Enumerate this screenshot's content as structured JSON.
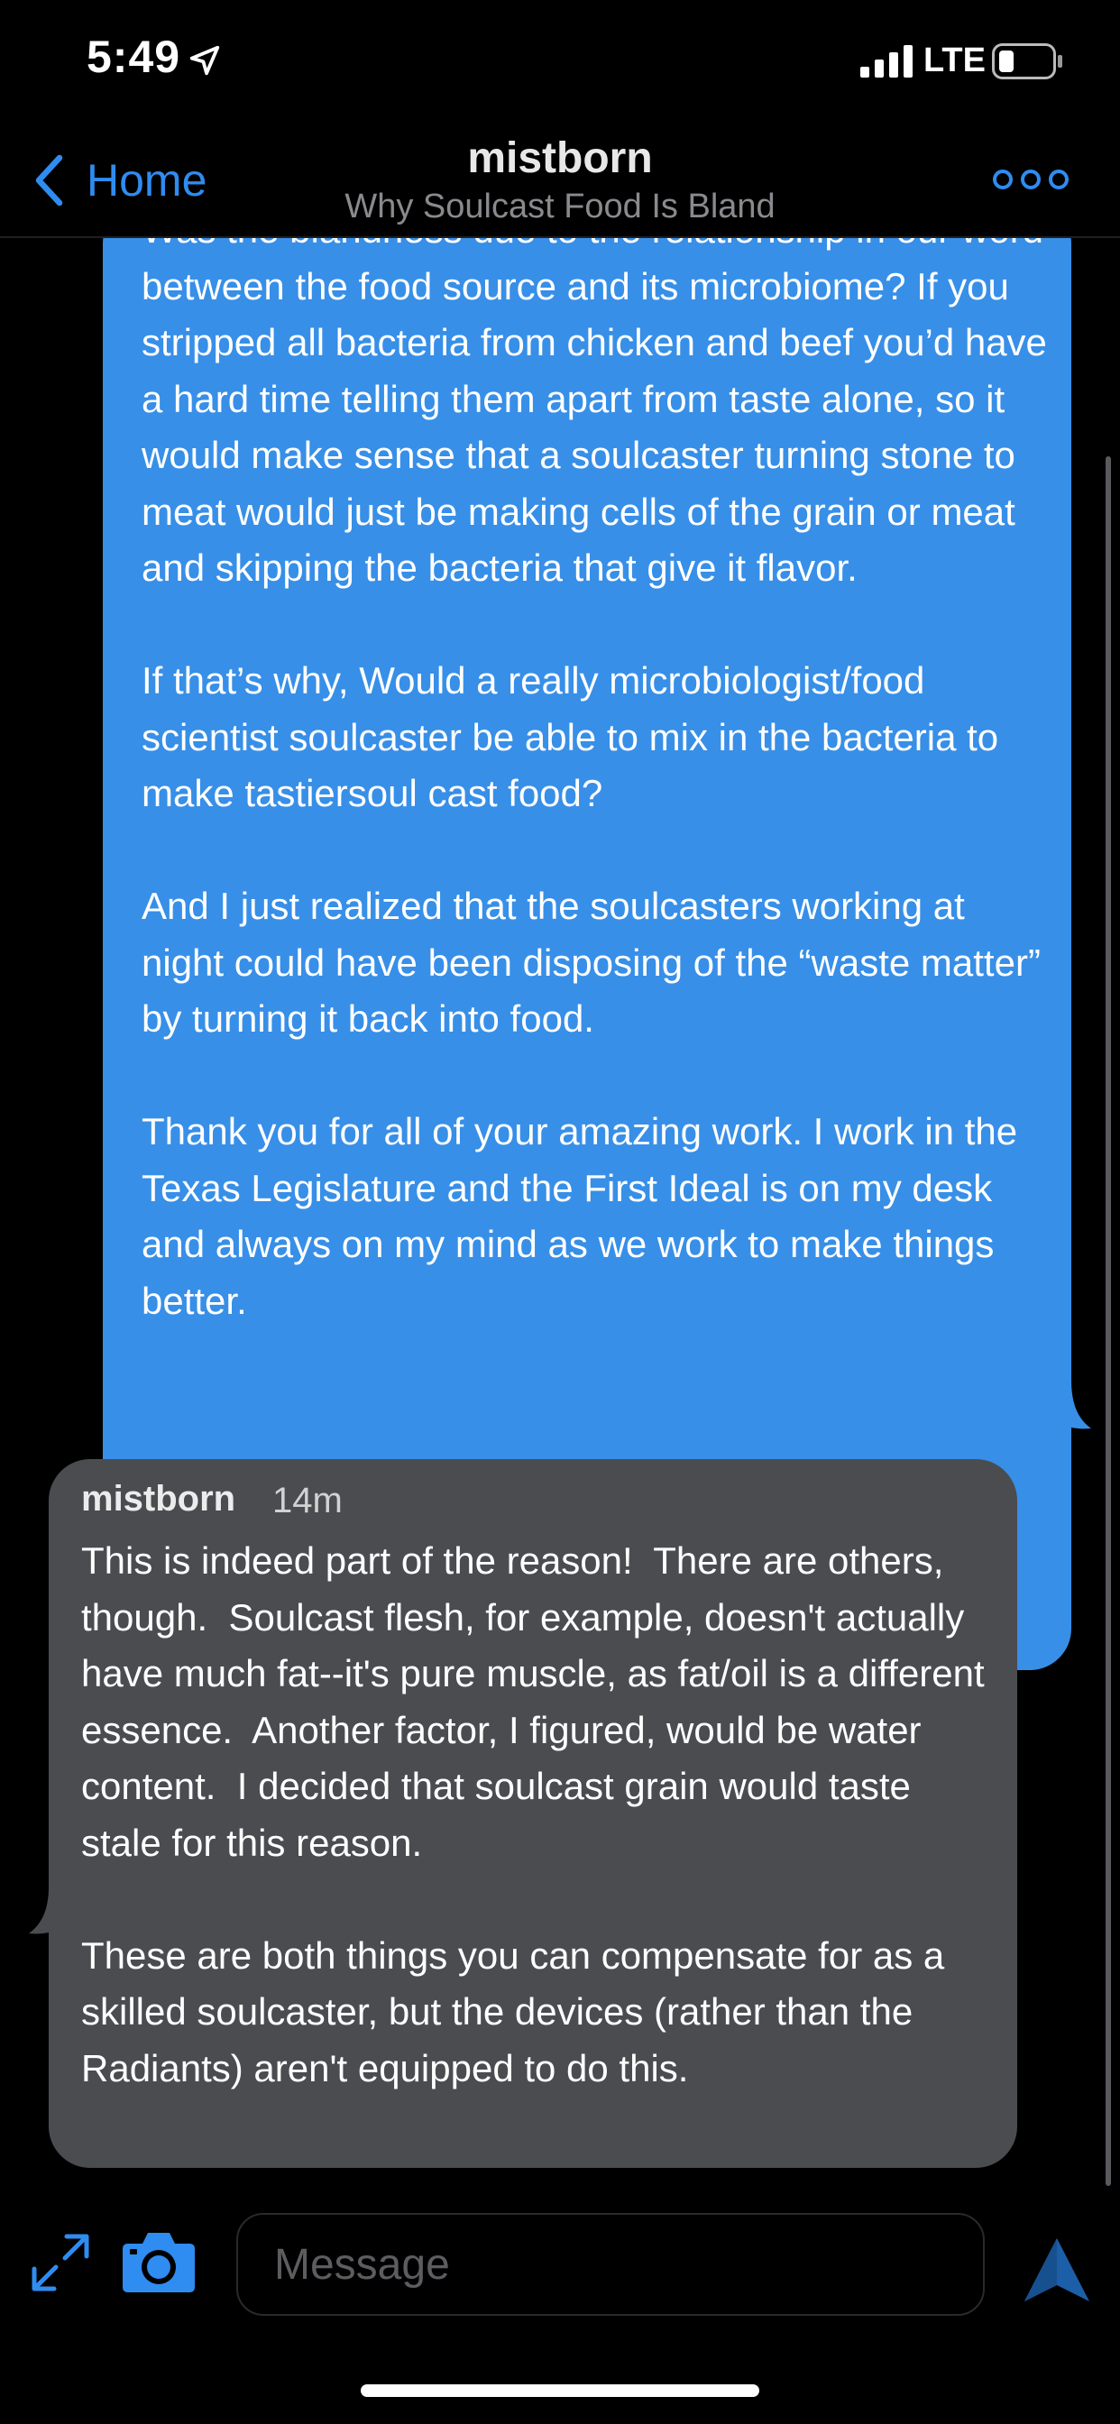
{
  "status_bar": {
    "time": "5:49",
    "network": "LTE",
    "location_icon": "location-arrow-icon",
    "signal_icon": "cellular-signal-icon",
    "battery_icon": "battery-low-icon"
  },
  "header": {
    "back_label": "Home",
    "title": "mistborn",
    "subtitle": "Why Soulcast Food Is Bland",
    "more_icon": "more-options-icon"
  },
  "messages": [
    {
      "direction": "outgoing",
      "text": "Was the blandness due to the relationship in our word between the food source and its microbiome? If you stripped all bacteria from chicken and beef you’d have a hard time telling them apart from taste alone, so it would make sense that a soulcaster turning stone to meat would just be making cells of the grain or meat and skipping the bacteria that give it flavor.\n\nIf that’s why, Would a really microbiologist/food scientist soulcaster be able to mix in the bacteria to make tastiersoul cast food?\n\nAnd I just realized that the soulcasters working at night could have been disposing of the “waste matter” by turning it back into food.\n\nThank you for all of your amazing work. I work in the Texas Legislature and the First Ideal is on my desk and always on my mind as we work to make things better.",
      "color": "#378fe8"
    },
    {
      "direction": "incoming",
      "author": "mistborn",
      "time": "14m",
      "text": "This is indeed part of the reason!  There are others, though.  Soulcast flesh, for example, doesn't actually have much fat--it's pure muscle, as fat/oil is a different essence.  Another factor, I figured, would be water content.  I decided that soulcast grain would taste stale for this reason.\n\nThese are both things you can compensate for as a skilled soulcaster, but the devices (rather than the Radiants) aren't equipped to do this.",
      "color": "#4a4c50"
    }
  ],
  "composer": {
    "placeholder": "Message",
    "expand_icon": "expand-icon",
    "camera_icon": "camera-icon",
    "send_icon": "send-icon"
  },
  "colors": {
    "accent": "#2f8cf0",
    "background": "#000000"
  }
}
